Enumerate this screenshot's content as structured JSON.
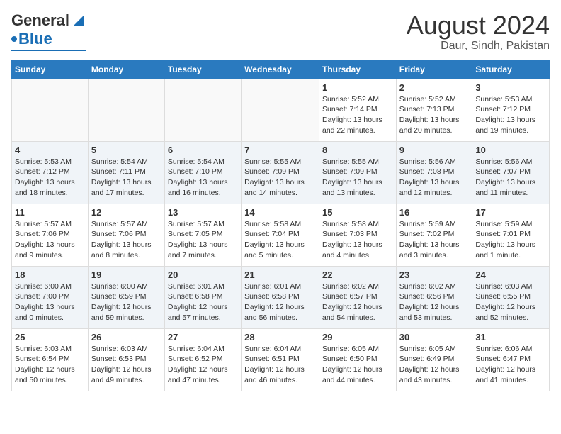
{
  "header": {
    "logo_general": "General",
    "logo_blue": "Blue",
    "title": "August 2024",
    "subtitle": "Daur, Sindh, Pakistan"
  },
  "calendar": {
    "weekdays": [
      "Sunday",
      "Monday",
      "Tuesday",
      "Wednesday",
      "Thursday",
      "Friday",
      "Saturday"
    ],
    "weeks": [
      [
        {
          "day": "",
          "info": ""
        },
        {
          "day": "",
          "info": ""
        },
        {
          "day": "",
          "info": ""
        },
        {
          "day": "",
          "info": ""
        },
        {
          "day": "1",
          "info": "Sunrise: 5:52 AM\nSunset: 7:14 PM\nDaylight: 13 hours\nand 22 minutes."
        },
        {
          "day": "2",
          "info": "Sunrise: 5:52 AM\nSunset: 7:13 PM\nDaylight: 13 hours\nand 20 minutes."
        },
        {
          "day": "3",
          "info": "Sunrise: 5:53 AM\nSunset: 7:12 PM\nDaylight: 13 hours\nand 19 minutes."
        }
      ],
      [
        {
          "day": "4",
          "info": "Sunrise: 5:53 AM\nSunset: 7:12 PM\nDaylight: 13 hours\nand 18 minutes."
        },
        {
          "day": "5",
          "info": "Sunrise: 5:54 AM\nSunset: 7:11 PM\nDaylight: 13 hours\nand 17 minutes."
        },
        {
          "day": "6",
          "info": "Sunrise: 5:54 AM\nSunset: 7:10 PM\nDaylight: 13 hours\nand 16 minutes."
        },
        {
          "day": "7",
          "info": "Sunrise: 5:55 AM\nSunset: 7:09 PM\nDaylight: 13 hours\nand 14 minutes."
        },
        {
          "day": "8",
          "info": "Sunrise: 5:55 AM\nSunset: 7:09 PM\nDaylight: 13 hours\nand 13 minutes."
        },
        {
          "day": "9",
          "info": "Sunrise: 5:56 AM\nSunset: 7:08 PM\nDaylight: 13 hours\nand 12 minutes."
        },
        {
          "day": "10",
          "info": "Sunrise: 5:56 AM\nSunset: 7:07 PM\nDaylight: 13 hours\nand 11 minutes."
        }
      ],
      [
        {
          "day": "11",
          "info": "Sunrise: 5:57 AM\nSunset: 7:06 PM\nDaylight: 13 hours\nand 9 minutes."
        },
        {
          "day": "12",
          "info": "Sunrise: 5:57 AM\nSunset: 7:06 PM\nDaylight: 13 hours\nand 8 minutes."
        },
        {
          "day": "13",
          "info": "Sunrise: 5:57 AM\nSunset: 7:05 PM\nDaylight: 13 hours\nand 7 minutes."
        },
        {
          "day": "14",
          "info": "Sunrise: 5:58 AM\nSunset: 7:04 PM\nDaylight: 13 hours\nand 5 minutes."
        },
        {
          "day": "15",
          "info": "Sunrise: 5:58 AM\nSunset: 7:03 PM\nDaylight: 13 hours\nand 4 minutes."
        },
        {
          "day": "16",
          "info": "Sunrise: 5:59 AM\nSunset: 7:02 PM\nDaylight: 13 hours\nand 3 minutes."
        },
        {
          "day": "17",
          "info": "Sunrise: 5:59 AM\nSunset: 7:01 PM\nDaylight: 13 hours\nand 1 minute."
        }
      ],
      [
        {
          "day": "18",
          "info": "Sunrise: 6:00 AM\nSunset: 7:00 PM\nDaylight: 13 hours\nand 0 minutes."
        },
        {
          "day": "19",
          "info": "Sunrise: 6:00 AM\nSunset: 6:59 PM\nDaylight: 12 hours\nand 59 minutes."
        },
        {
          "day": "20",
          "info": "Sunrise: 6:01 AM\nSunset: 6:58 PM\nDaylight: 12 hours\nand 57 minutes."
        },
        {
          "day": "21",
          "info": "Sunrise: 6:01 AM\nSunset: 6:58 PM\nDaylight: 12 hours\nand 56 minutes."
        },
        {
          "day": "22",
          "info": "Sunrise: 6:02 AM\nSunset: 6:57 PM\nDaylight: 12 hours\nand 54 minutes."
        },
        {
          "day": "23",
          "info": "Sunrise: 6:02 AM\nSunset: 6:56 PM\nDaylight: 12 hours\nand 53 minutes."
        },
        {
          "day": "24",
          "info": "Sunrise: 6:03 AM\nSunset: 6:55 PM\nDaylight: 12 hours\nand 52 minutes."
        }
      ],
      [
        {
          "day": "25",
          "info": "Sunrise: 6:03 AM\nSunset: 6:54 PM\nDaylight: 12 hours\nand 50 minutes."
        },
        {
          "day": "26",
          "info": "Sunrise: 6:03 AM\nSunset: 6:53 PM\nDaylight: 12 hours\nand 49 minutes."
        },
        {
          "day": "27",
          "info": "Sunrise: 6:04 AM\nSunset: 6:52 PM\nDaylight: 12 hours\nand 47 minutes."
        },
        {
          "day": "28",
          "info": "Sunrise: 6:04 AM\nSunset: 6:51 PM\nDaylight: 12 hours\nand 46 minutes."
        },
        {
          "day": "29",
          "info": "Sunrise: 6:05 AM\nSunset: 6:50 PM\nDaylight: 12 hours\nand 44 minutes."
        },
        {
          "day": "30",
          "info": "Sunrise: 6:05 AM\nSunset: 6:49 PM\nDaylight: 12 hours\nand 43 minutes."
        },
        {
          "day": "31",
          "info": "Sunrise: 6:06 AM\nSunset: 6:47 PM\nDaylight: 12 hours\nand 41 minutes."
        }
      ]
    ]
  }
}
